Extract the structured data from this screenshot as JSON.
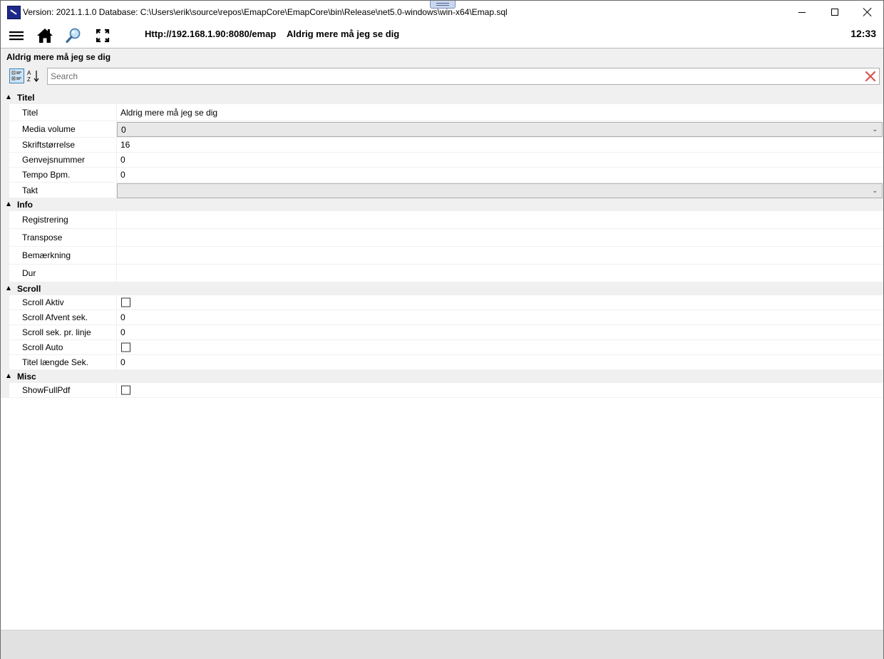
{
  "window": {
    "title": "Version: 2021.1.1.0 Database: C:\\Users\\erik\\source\\repos\\EmapCore\\EmapCore\\bin\\Release\\net5.0-windows\\win-x64\\Emap.sql",
    "app_icon": "emap-app-icon"
  },
  "toolbar": {
    "menu_icon": "hamburger-menu-icon",
    "home_icon": "home-icon",
    "zoom_icon": "magnifier-icon",
    "fullscreen_icon": "fullscreen-icon",
    "url": "Http://192.168.1.90:8080/emap",
    "song": "Aldrig mere må jeg se dig",
    "clock": "12:33"
  },
  "header": {
    "title": "Aldrig mere må jeg se dig",
    "search_placeholder": "Search"
  },
  "categories": [
    {
      "label": "Titel"
    },
    {
      "label": "Info"
    },
    {
      "label": "Scroll"
    },
    {
      "label": "Misc"
    }
  ],
  "props": {
    "titel": {
      "name": "Titel",
      "value": "Aldrig mere må jeg se dig"
    },
    "media_volume": {
      "name": "Media volume",
      "value": "0"
    },
    "skriftstorrelse": {
      "name": "Skriftstørrelse",
      "value": "16"
    },
    "genvejsnummer": {
      "name": "Genvejsnummer",
      "value": "0"
    },
    "tempo": {
      "name": "Tempo Bpm.",
      "value": "0"
    },
    "takt": {
      "name": "Takt",
      "value": ""
    },
    "registrering": {
      "name": "Registrering",
      "value": ""
    },
    "transpose": {
      "name": "Transpose",
      "value": ""
    },
    "bemaerkning": {
      "name": "Bemærkning",
      "value": ""
    },
    "dur": {
      "name": "Dur",
      "value": ""
    },
    "scroll_aktiv": {
      "name": "Scroll Aktiv",
      "checked": false
    },
    "scroll_afvent": {
      "name": "Scroll Afvent sek.",
      "value": "0"
    },
    "scroll_sek_linje": {
      "name": "Scroll sek. pr. linje",
      "value": "0"
    },
    "scroll_auto": {
      "name": "Scroll Auto",
      "checked": false
    },
    "titel_laengde": {
      "name": "Titel længde Sek.",
      "value": "0"
    },
    "show_full_pdf": {
      "name": "ShowFullPdf",
      "checked": false
    }
  },
  "colors": {
    "accent_blue": "#3c7fb1",
    "clear_red": "#d9534f"
  }
}
